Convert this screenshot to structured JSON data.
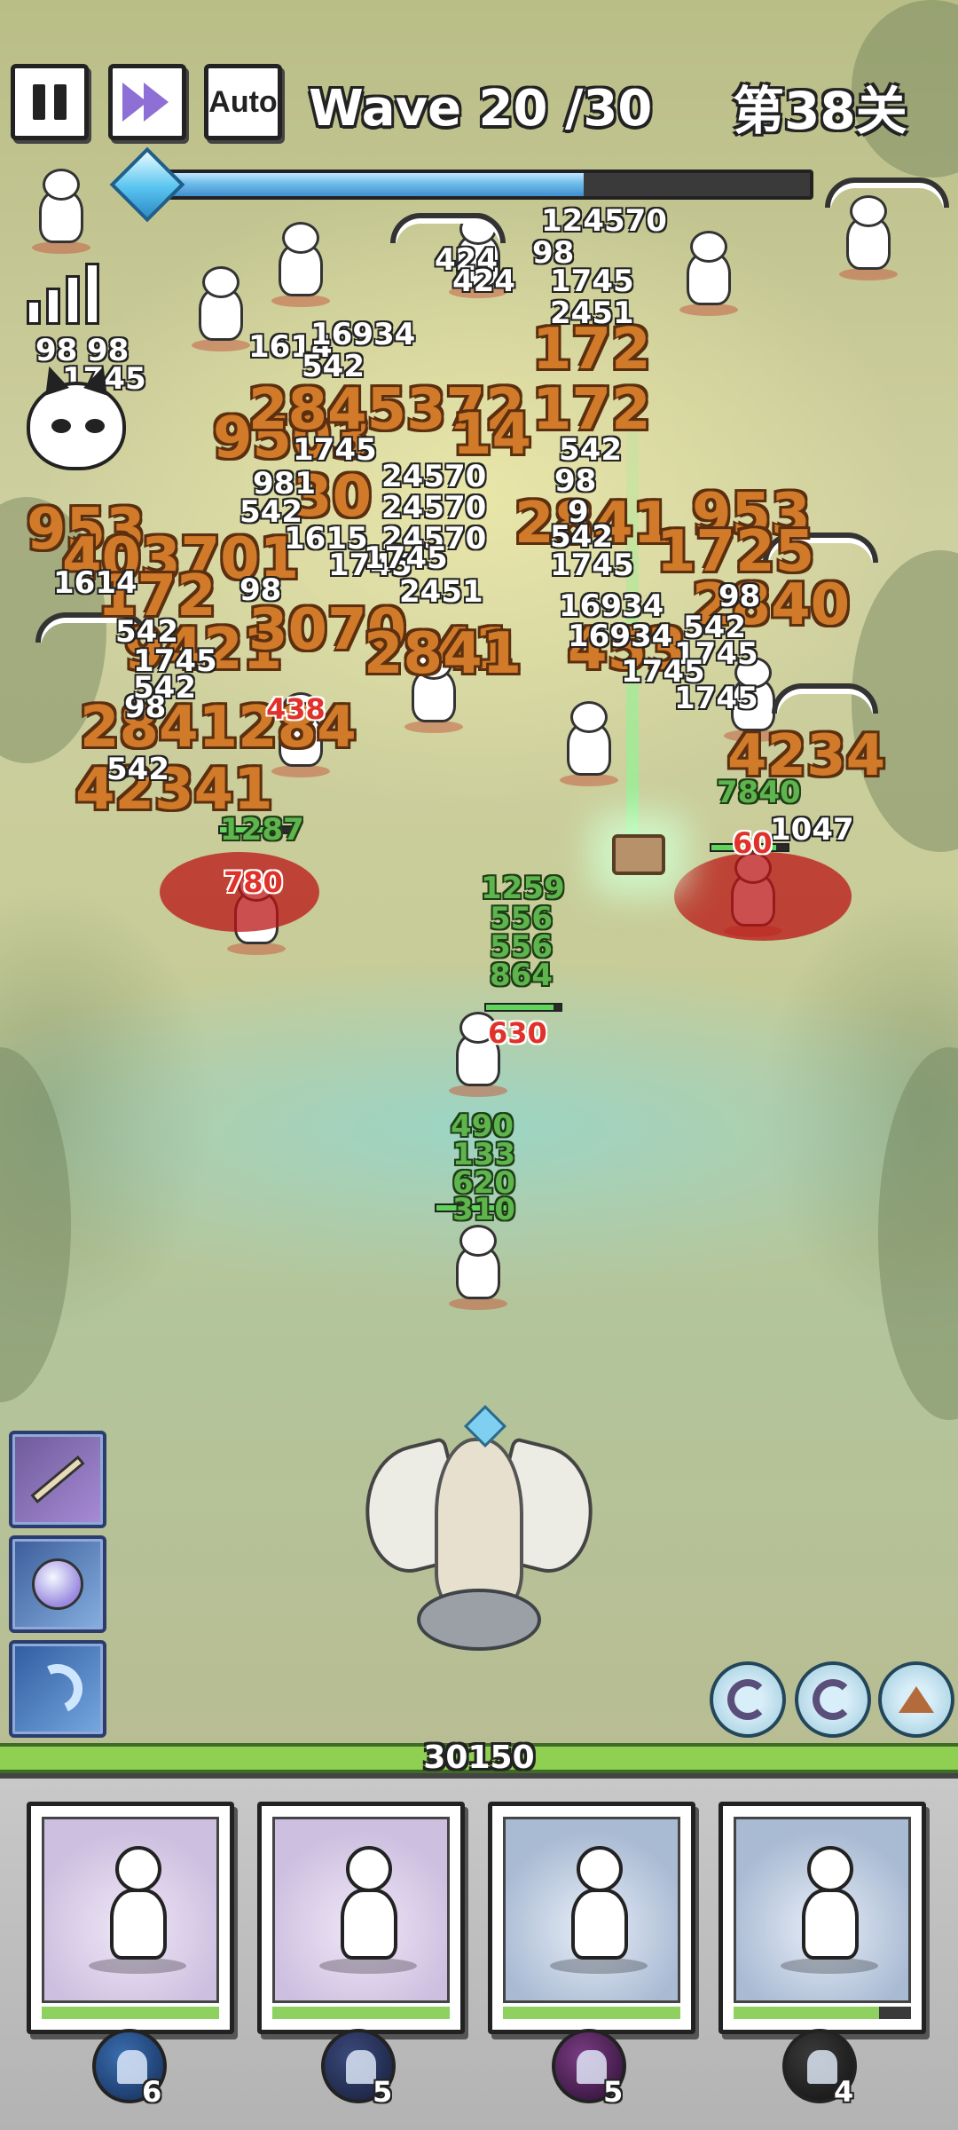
{
  "hud": {
    "pause_icon": "pause-icon",
    "fast_forward_icon": "fast-forward-icon",
    "auto_label": "Auto",
    "wave_text": "Wave 20 /30",
    "level_text": "第38关",
    "wave_progress": 0.66,
    "colors": {
      "progress_fill": "#6fbde9",
      "accent_purple": "#8d6fd6"
    }
  },
  "damage_numbers": {
    "big": [
      "953",
      "403701",
      "172",
      "2841284",
      "42341",
      "9503",
      "2845372",
      "14",
      "30",
      "9421",
      "3070",
      "41",
      "2841",
      "172",
      "172",
      "2841",
      "953",
      "1725",
      "2840",
      "453",
      "4234"
    ],
    "small": [
      "98",
      "98",
      "1745",
      "1614",
      "16934",
      "542",
      "424",
      "424",
      "1745",
      "981",
      "542",
      "24570",
      "24570",
      "1745",
      "24570",
      "2451",
      "1615",
      "124570",
      "98",
      "1745",
      "2451",
      "542",
      "98",
      "1745",
      "16934",
      "542",
      "1614",
      "98",
      "1745",
      "542",
      "1745",
      "98",
      "542",
      "16934",
      "1745",
      "1745",
      "98",
      "1047",
      "542",
      "1745",
      "542",
      "9"
    ],
    "green": [
      "1287",
      "1259",
      "556",
      "556",
      "864",
      "7840",
      "490",
      "133",
      "620",
      "310"
    ],
    "red": [
      "438",
      "780",
      "60",
      "630"
    ]
  },
  "skills": [
    {
      "name": "dagger-skill-icon"
    },
    {
      "name": "crystal-orb-skill-icon"
    },
    {
      "name": "hook-skill-icon"
    }
  ],
  "abilities": [
    {
      "name": "vortex-ability-icon"
    },
    {
      "name": "vortex-ability-icon"
    },
    {
      "name": "upgrade-arrow-icon"
    }
  ],
  "base": {
    "hp_text": "30150",
    "colors": {
      "hp_fill": "#8fcf52"
    }
  },
  "cards": [
    {
      "hero": "hooded-archer",
      "badge_icon": "feather-badge-icon",
      "count": "6",
      "cooldown": 1.0
    },
    {
      "hero": "swordsman",
      "badge_icon": "helmet-badge-icon",
      "count": "5",
      "cooldown": 1.0
    },
    {
      "hero": "hooded-mage",
      "badge_icon": "crow-badge-icon",
      "count": "5",
      "cooldown": 1.0
    },
    {
      "hero": "beast-warrior",
      "badge_icon": "beast-badge-icon",
      "count": "4",
      "cooldown": 0.82
    }
  ]
}
